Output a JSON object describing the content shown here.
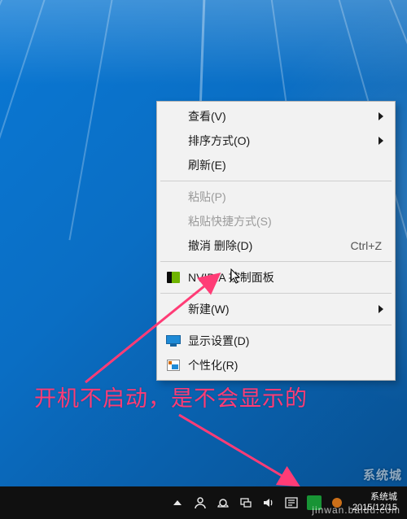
{
  "context_menu": {
    "view": {
      "label": "查看(V)",
      "has_submenu": true
    },
    "sort": {
      "label": "排序方式(O)",
      "has_submenu": true
    },
    "refresh": {
      "label": "刷新(E)"
    },
    "paste": {
      "label": "粘贴(P)",
      "disabled": true
    },
    "paste_short": {
      "label": "粘贴快捷方式(S)",
      "disabled": true
    },
    "undo": {
      "label": "撤消 删除(D)",
      "shortcut": "Ctrl+Z"
    },
    "nvidia": {
      "label": "NVIDIA 控制面板"
    },
    "new": {
      "label": "新建(W)",
      "has_submenu": true
    },
    "display": {
      "label": "显示设置(D)"
    },
    "personalize": {
      "label": "个性化(R)"
    }
  },
  "annotation": {
    "text": "开机不启动，是不会显示的"
  },
  "taskbar": {
    "clock_line1": "系统城",
    "clock_line2": "2015/12/15"
  },
  "watermark": {
    "text": "系统城"
  },
  "watermark_bottom": {
    "text": "jinwan.baidu.com"
  },
  "colors": {
    "annotation_pink": "#ff3c76",
    "menu_bg": "#f2f2f2",
    "taskbar_bg": "#101010"
  }
}
